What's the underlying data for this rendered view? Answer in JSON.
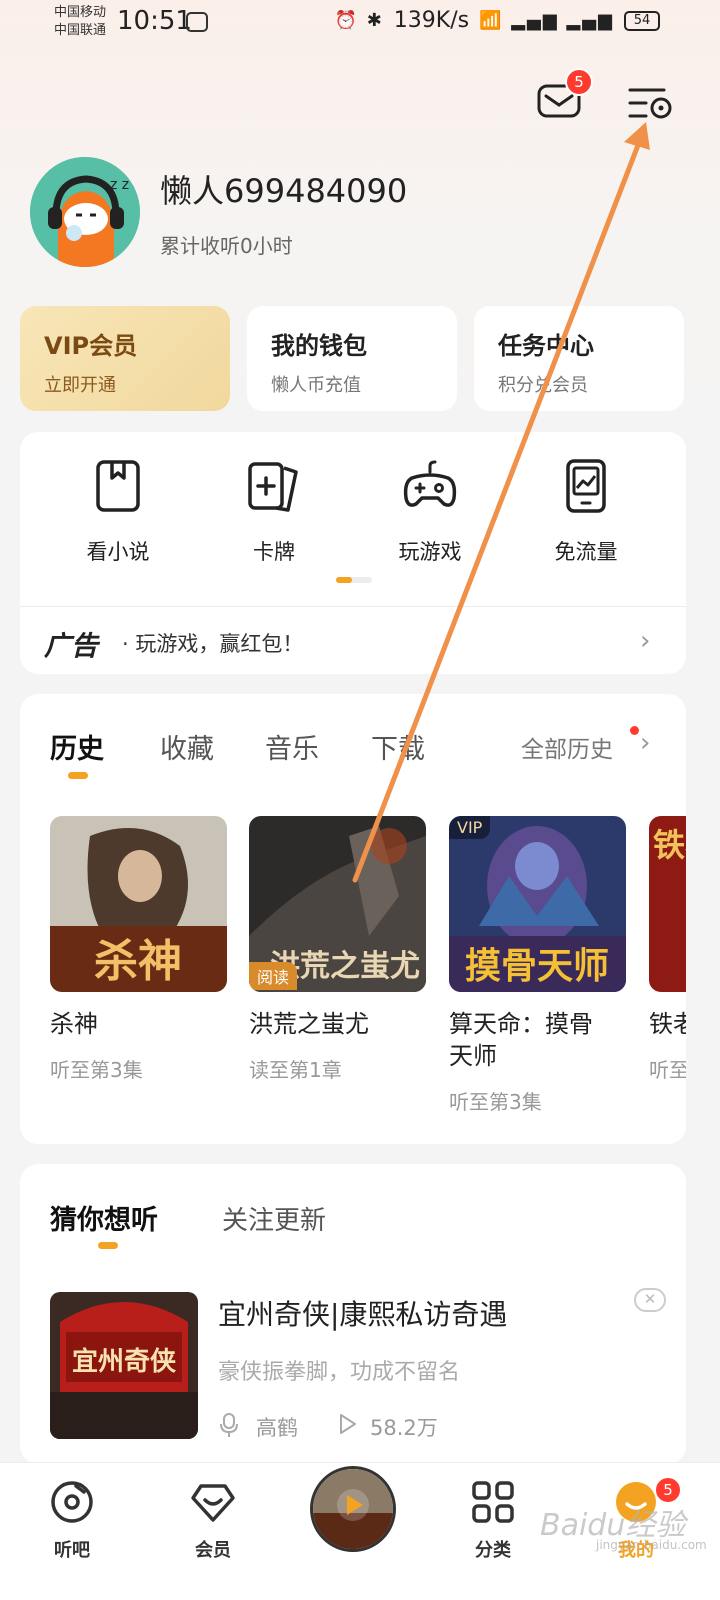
{
  "status_bar": {
    "carrier1": "中国移动",
    "carrier2": "中国联通",
    "time": "10:51",
    "network_speed": "139K/s",
    "battery": "54"
  },
  "header": {
    "mail_badge": "5"
  },
  "profile": {
    "username": "懒人699484090",
    "listen_time": "累计收听0小时"
  },
  "top_cards": [
    {
      "title": "VIP会员",
      "subtitle": "立即开通"
    },
    {
      "title": "我的钱包",
      "subtitle": "懒人币充值"
    },
    {
      "title": "任务中心",
      "subtitle": "积分兑会员"
    }
  ],
  "features": [
    {
      "label": "看小说",
      "icon": "book-icon"
    },
    {
      "label": "卡牌",
      "icon": "cards-icon"
    },
    {
      "label": "玩游戏",
      "icon": "gamepad-icon"
    },
    {
      "label": "免流量",
      "icon": "phone-chart-icon"
    }
  ],
  "ad": {
    "mark": "广告",
    "text": "· 玩游戏，赢红包！"
  },
  "history": {
    "tabs": [
      "历史",
      "收藏",
      "音乐",
      "下载"
    ],
    "all_label": "全部历史",
    "items": [
      {
        "title": "杀神",
        "progress": "听至第3集",
        "cover_text": "杀神"
      },
      {
        "title": "洪荒之蚩尤",
        "progress": "读至第1章",
        "tag": "阅读",
        "cover_text": "洪荒之蚩尤"
      },
      {
        "title_line1": "算天命：摸骨",
        "title_line2": "天师",
        "progress": "听至第3集",
        "tag": "VIP",
        "cover_text": "摸骨天师"
      },
      {
        "title": "铁老",
        "progress": "听至",
        "cover_text": "铁老大"
      }
    ]
  },
  "recommend": {
    "tabs": [
      "猜你想听",
      "关注更新"
    ],
    "item": {
      "title": "宜州奇侠|康熙私访奇遇",
      "desc": "豪侠振拳脚，功成不留名",
      "author": "高鹤",
      "plays": "58.2万",
      "cover_text": "宜州奇侠"
    }
  },
  "bottom_nav": {
    "items": [
      "听吧",
      "会员",
      "分类",
      "我的"
    ],
    "mine_badge": "5"
  },
  "watermark": {
    "main": "Baidu经验",
    "sub": "jingyan.baidu.com"
  },
  "colors": {
    "accent": "#f3a221",
    "badge_red": "#ff3b30",
    "annotation_arrow": "#f0914a"
  }
}
